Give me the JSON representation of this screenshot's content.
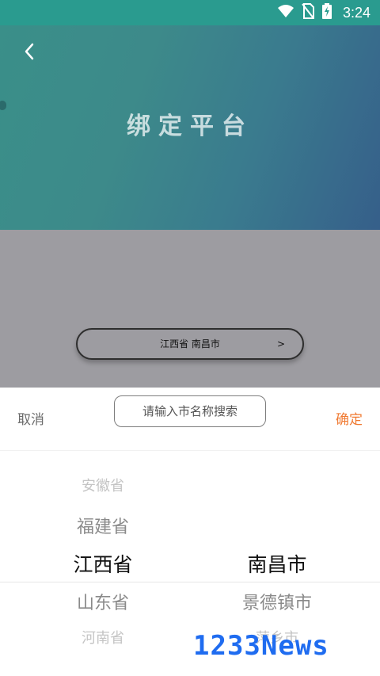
{
  "status_bar": {
    "time": "3:24",
    "icons": [
      "wifi-icon",
      "no-sim-icon",
      "battery-charging-icon"
    ]
  },
  "header": {
    "title": "绑定平台",
    "back_icon": "chevron-left-icon"
  },
  "region_selector": {
    "label": "江西省 南昌市",
    "arrow": ">"
  },
  "picker": {
    "cancel_label": "取消",
    "confirm_label": "确定",
    "search_placeholder": "请输入市名称搜索",
    "provinces": [
      "安徽省",
      "福建省",
      "江西省",
      "山东省",
      "河南省"
    ],
    "cities": [
      "南昌市",
      "景德镇市",
      "萍乡市"
    ],
    "selected_province": "江西省",
    "selected_city": "南昌市"
  },
  "watermark": "1233News",
  "colors": {
    "accent": "#f07a32",
    "header_start": "#3a8f89",
    "header_end": "#365f8a",
    "status_bar": "#2a9b8f"
  }
}
